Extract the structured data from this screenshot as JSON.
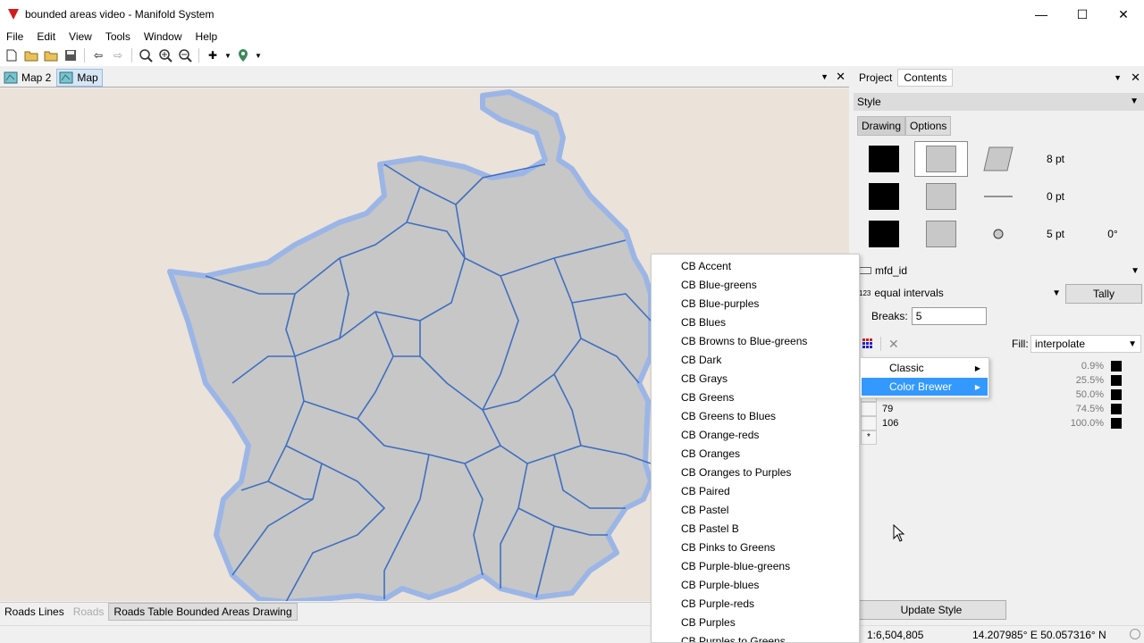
{
  "window": {
    "title": "bounded areas video - Manifold System",
    "controls": [
      "—",
      "☐",
      "✕"
    ]
  },
  "menu": [
    "File",
    "Edit",
    "View",
    "Tools",
    "Window",
    "Help"
  ],
  "map_tabs": [
    "Map 2",
    "Map"
  ],
  "layer_tabs": [
    "Roads Lines",
    "Roads",
    "Roads Table Bounded Areas Drawing"
  ],
  "panel": {
    "tabs": [
      "Project",
      "Contents"
    ],
    "section": "Style",
    "subtabs": [
      "Drawing",
      "Options"
    ],
    "swatch_values": {
      "size1": "8 pt",
      "size2": "0 pt",
      "size3": "5 pt",
      "rotation": "0°"
    },
    "field": "mfd_id",
    "method": "equal intervals",
    "method_prefix": "123",
    "tally": "Tally",
    "breaks_label": "Breaks:",
    "breaks_value": "5",
    "fill_label": "Fill:",
    "fill_value": "interpolate",
    "rows": [
      {
        "value": "",
        "pct": "0.9%"
      },
      {
        "value": "",
        "pct": "25.5%"
      },
      {
        "value": "",
        "pct": "50.0%"
      },
      {
        "value": "79",
        "pct": "74.5%"
      },
      {
        "value": "106",
        "pct": "100.0%"
      }
    ],
    "new_row_marker": "*",
    "update_button": "Update Style"
  },
  "status": {
    "scale": "1:6,504,805",
    "coords": "14.207985° E 50.057316° N"
  },
  "palette_menu": [
    "CB Accent",
    "CB Blue-greens",
    "CB Blue-purples",
    "CB Blues",
    "CB Browns to Blue-greens",
    "CB Dark",
    "CB Grays",
    "CB Greens",
    "CB Greens to Blues",
    "CB Orange-reds",
    "CB Oranges",
    "CB Oranges to Purples",
    "CB Paired",
    "CB Pastel",
    "CB Pastel B",
    "CB Pinks to Greens",
    "CB Purple-blue-greens",
    "CB Purple-blues",
    "CB Purple-reds",
    "CB Purples",
    "CB Purples to Greens"
  ],
  "palette_submenu": [
    {
      "label": "Classic",
      "highlighted": false
    },
    {
      "label": "Color Brewer",
      "highlighted": true
    }
  ],
  "colors": {
    "accent": "#3399ff",
    "map_bg": "#ebe2da",
    "area_fill": "#c7c7c7",
    "road": "#4a78c8"
  }
}
